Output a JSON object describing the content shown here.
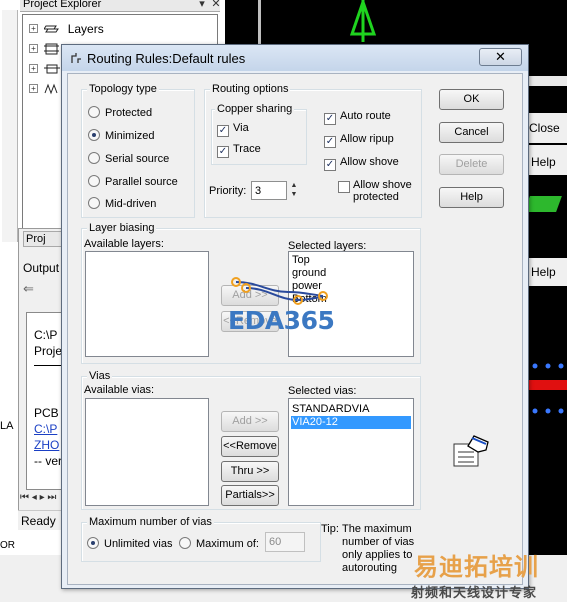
{
  "background": {
    "project_explorer_title": "Project Explorer",
    "tree_items": [
      {
        "label": "Layers"
      },
      {
        "label": ""
      },
      {
        "label": ""
      },
      {
        "label": ""
      }
    ],
    "panel_tab_label": "Proj",
    "output_label": "Output",
    "output_lines": [
      "C:\\P",
      "Proje",
      "PCB",
      "C:\\P",
      "ZHO",
      "-- ver"
    ],
    "status_text": "Ready",
    "right_labels": {
      "close": "Close",
      "help1": "Help",
      "help2": "Help"
    },
    "left_edge_text": [
      "LA",
      "OR"
    ]
  },
  "dialog": {
    "title": "Routing Rules:Default rules",
    "close_glyph": "✕",
    "topology": {
      "label": "Topology type",
      "options": [
        "Protected",
        "Minimized",
        "Serial source",
        "Parallel source",
        "Mid-driven"
      ],
      "selected": "Minimized"
    },
    "routing_options": {
      "label": "Routing options",
      "copper_sharing_label": "Copper sharing",
      "via_label": "Via",
      "trace_label": "Trace",
      "auto_route_label": "Auto route",
      "allow_ripup_label": "Allow ripup",
      "allow_shove_label": "Allow shove",
      "allow_shove_protected_label": "Allow shove protected",
      "priority_label": "Priority:",
      "priority_value": "3"
    },
    "buttons": {
      "ok": "OK",
      "cancel": "Cancel",
      "delete": "Delete",
      "help": "Help"
    },
    "layer_biasing": {
      "label": "Layer biasing",
      "available_label": "Available layers:",
      "selected_label": "Selected layers:",
      "selected_layers": [
        "Top",
        "ground",
        "power",
        "Bottom"
      ],
      "add_label": "Add >>",
      "remove_label": "<<Remove"
    },
    "vias": {
      "label": "Vias",
      "available_label": "Available vias:",
      "selected_label": "Selected vias:",
      "selected_vias": [
        "STANDARDVIA",
        "VIA20-12"
      ],
      "selected_index": 1,
      "add_label": "Add >>",
      "remove_label": "<<Remove",
      "thru_label": "Thru >>",
      "partials_label": "Partials>>"
    },
    "max_vias": {
      "label": "Maximum number of vias",
      "unlimited_label": "Unlimited vias",
      "maximum_label": "Maximum of:",
      "maximum_value": "60",
      "selected": "Unlimited vias"
    },
    "tip": {
      "prefix": "Tip:",
      "text": "The maximum number of vias only applies to autorouting"
    }
  },
  "watermarks": {
    "eda": "EDA365",
    "cn_title": "易迪拓培训",
    "cn_subtitle": "射频和天线设计专家"
  }
}
